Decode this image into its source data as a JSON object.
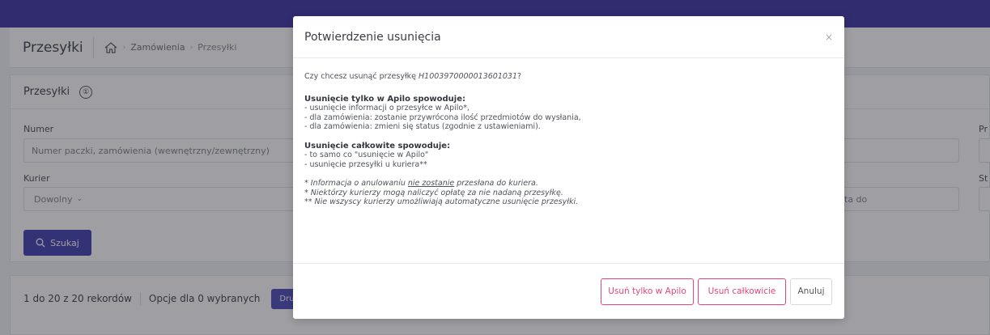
{
  "header": {
    "title": "Przesyłki",
    "breadcrumbs": [
      "Zamówienia",
      "Przesyłki"
    ]
  },
  "filters": {
    "panel_title": "Przesyłki",
    "count_badge": "①",
    "numer_label": "Numer",
    "numer_placeholder": "Numer paczki, zamówienia (wewnętrzny/zewnętrzny)",
    "kurier_label": "Kurier",
    "kurier_value": "Dowolny",
    "right_label_1": "Pr",
    "right_label_2": "St",
    "data_do_placeholder": "ta do",
    "search_button": "Szukaj"
  },
  "results": {
    "records": "1 do 20 z 20 rekordów",
    "options": "Opcje dla 0 wybranych",
    "print_button": "Druk"
  },
  "modal": {
    "title": "Potwierdzenie usunięcia",
    "close": "×",
    "question_prefix": "Czy chcesz usunąć przesyłkę ",
    "tracking": "H1003970000013601031",
    "question_suffix": "?",
    "section1_title": "Usunięcie tylko w Apilo spowoduje:",
    "section1_items": [
      "- usunięcie informacji o przesyłce w Apilo*,",
      "- dla zamówienia: zostanie przywrócona ilość przedmiotów do wysłania,",
      "- dla zamówienia: zmieni się status (zgodnie z ustawieniami)."
    ],
    "section2_title": "Usunięcie całkowite spowoduje:",
    "section2_items": [
      "- to samo co \"usunięcie w Apilo\"",
      "- usunięcie przesyłki u kuriera**"
    ],
    "note1_prefix": "* Informacja o anulowaniu ",
    "note1_underline": "nie zostanie",
    "note1_suffix": " przesłana do kuriera.",
    "note2": "* Niektórzy kurierzy mogą naliczyć opłatę za nie nadaną przesyłkę.",
    "note3": "** Nie wszyscy kurierzy umożliwiają automatyczne usunięcie przesyłki.",
    "btn_apilo": "Usuń tylko w Apilo",
    "btn_full": "Usuń całkowicie",
    "btn_cancel": "Anuluj"
  },
  "colors": {
    "topbar": "#3a31a0",
    "primary": "#3d3bb0",
    "danger": "#e6457b"
  }
}
